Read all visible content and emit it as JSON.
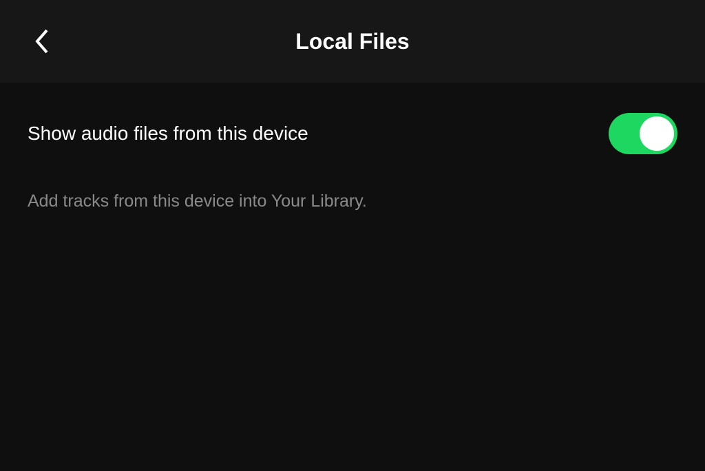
{
  "header": {
    "title": "Local Files"
  },
  "settings": {
    "show_audio_label": "Show audio files from this device",
    "show_audio_enabled": true,
    "description": "Add tracks from this device into Your Library."
  },
  "colors": {
    "accent": "#1ed760",
    "background": "#0f0f0f",
    "header_bg": "#171717",
    "text_primary": "#ffffff",
    "text_secondary": "#8a8a8a"
  }
}
